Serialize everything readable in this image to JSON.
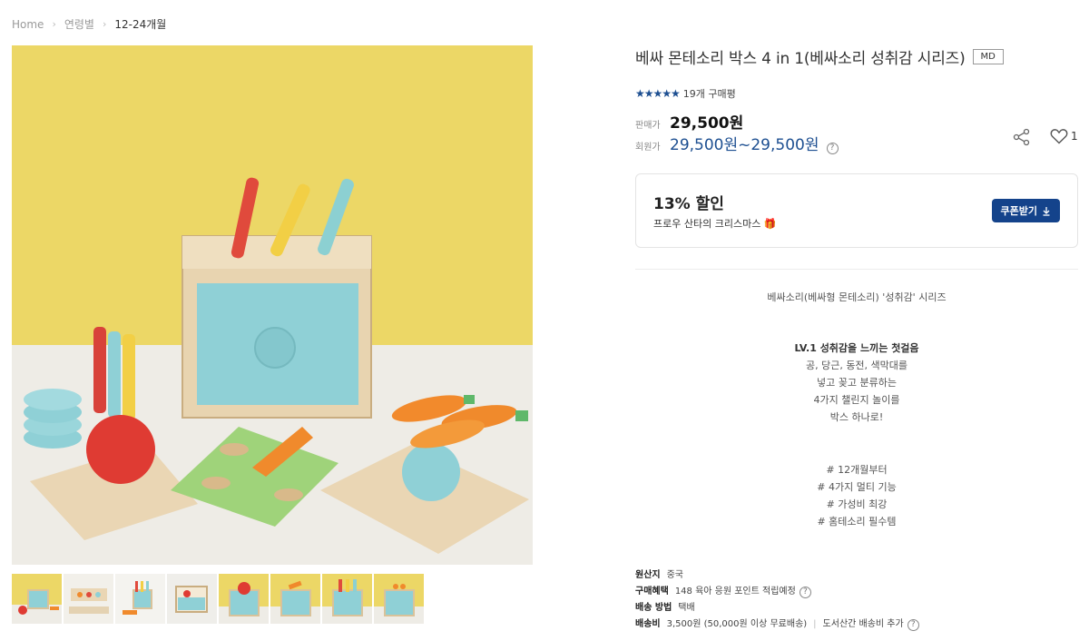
{
  "breadcrumb": {
    "home": "Home",
    "category": "연령별",
    "current": "12-24개월"
  },
  "product": {
    "title": "베싸 몬테소리 박스 4 in 1(베싸소리 성취감 시리즈)",
    "badge": "MD",
    "stars": "★★★★★",
    "reviews": "19개 구매평",
    "sale_label": "판매가",
    "sale_price": "29,500원",
    "member_label": "회원가",
    "member_price": "29,500원~29,500원",
    "help_glyph": "?",
    "like_count": "1"
  },
  "coupon": {
    "discount": "13% 할인",
    "description": "프로우 산타의 크리스마스 🎁",
    "button_label": "쿠폰받기"
  },
  "description": {
    "series": "베싸소리(베싸형 몬테소리) '성취감' 시리즈",
    "lines1": [
      "LV.1 성취감을 느끼는 첫걸음",
      "공, 당근, 동전, 색막대를",
      "넣고 꽂고 분류하는",
      "4가지 챌린지 놀이를",
      "박스 하나로!"
    ],
    "lines2": [
      "# 12개월부터",
      "# 4가지 멀티 기능",
      "# 가성비 최강",
      "# 홈테소리 필수템"
    ]
  },
  "specs": {
    "origin_label": "원산지",
    "origin": "중국",
    "benefit_label": "구매혜택",
    "benefit": "148 육아 응원 포인트 적립예정",
    "shipping_label": "배송 방법",
    "shipping": "택배",
    "fee_label": "배송비",
    "fee": "3,500원 (50,000원 이상 무료배송)",
    "fee_extra": "도서산간 배송비 추가"
  },
  "colors": {
    "accent": "#14438b",
    "member_price": "#1d4f91",
    "background_yellow": "#ecd766",
    "box_mint": "#8fd0d6"
  },
  "thumbnails": [
    "thumb-1",
    "thumb-2",
    "thumb-3",
    "thumb-4",
    "thumb-5",
    "thumb-6",
    "thumb-7",
    "thumb-8"
  ]
}
